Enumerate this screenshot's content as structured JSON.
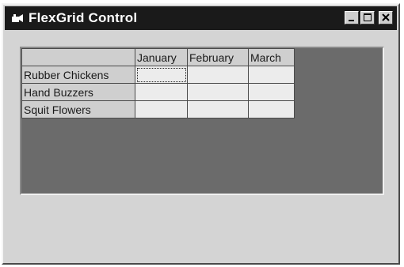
{
  "window": {
    "title": "FlexGrid Control",
    "titlebar_color": "#1a1a1a",
    "face_color": "#d4d4d4"
  },
  "titlebar_buttons": {
    "minimize_icon": "minimize-icon",
    "maximize_icon": "maximize-icon",
    "close_icon": "close-icon"
  },
  "flexgrid": {
    "background_color": "#6b6b6b",
    "columns": [
      "",
      "January",
      "February",
      "March"
    ],
    "rows": [
      {
        "label": "Rubber Chickens",
        "values": [
          "",
          "",
          ""
        ]
      },
      {
        "label": "Hand Buzzers",
        "values": [
          "",
          "",
          ""
        ]
      },
      {
        "label": "Squit Flowers",
        "values": [
          "",
          "",
          ""
        ]
      }
    ],
    "current_cell": {
      "row": 0,
      "col": 1
    }
  }
}
